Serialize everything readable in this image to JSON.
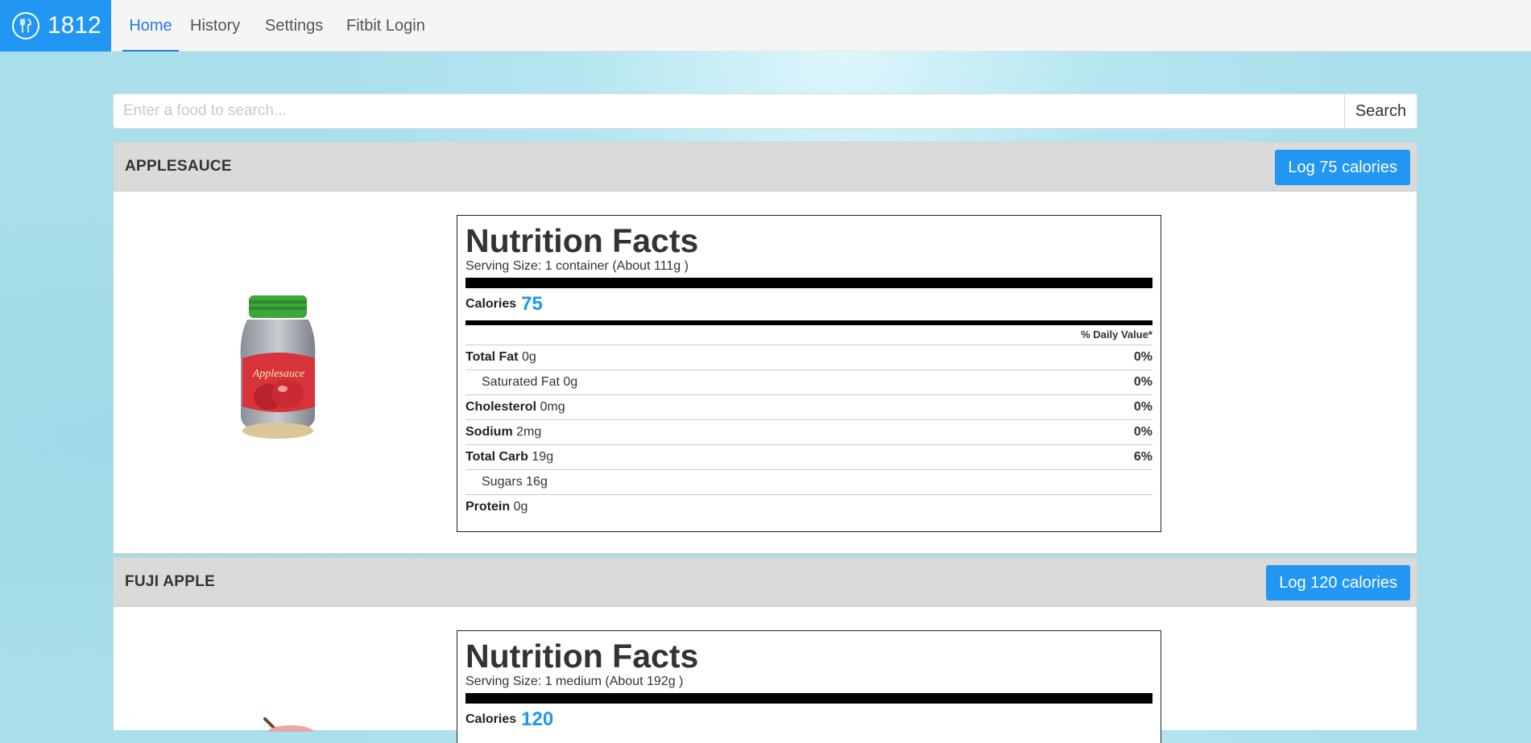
{
  "nav": {
    "brand": "1812",
    "items": [
      "Home",
      "History",
      "Settings",
      "Fitbit Login"
    ],
    "active": "Home"
  },
  "search": {
    "placeholder": "Enter a food to search...",
    "value": "",
    "button_label": "Search"
  },
  "foods": [
    {
      "name": "APPLESAUCE",
      "log_label": "Log 75 calories",
      "label": {
        "title": "Nutrition Facts",
        "serving": "Serving Size: 1 container (About 111g )",
        "calories_label": "Calories",
        "calories": "75",
        "dv_header": "% Daily Value*",
        "rows": [
          {
            "name": "Total Fat",
            "amount": "0g",
            "pct": "0%"
          },
          {
            "name": "Saturated Fat",
            "amount": "0g",
            "pct": "0%"
          },
          {
            "name": "Cholesterol",
            "amount": "0mg",
            "pct": "0%"
          },
          {
            "name": "Sodium",
            "amount": "2mg",
            "pct": "0%"
          },
          {
            "name": "Total Carb",
            "amount": "19g",
            "pct": "6%"
          },
          {
            "name": "Sugars",
            "amount": "16g",
            "pct": ""
          },
          {
            "name": "Protein",
            "amount": "0g",
            "pct": ""
          }
        ]
      }
    },
    {
      "name": "FUJI APPLE",
      "log_label": "Log 120 calories",
      "label": {
        "title": "Nutrition Facts",
        "serving": "Serving Size: 1 medium (About 192g )",
        "calories_label": "Calories",
        "calories": "120"
      }
    }
  ],
  "colors": {
    "accent": "#2196f3",
    "active_nav": "#2a7ae2",
    "card_header": "#dadada"
  }
}
